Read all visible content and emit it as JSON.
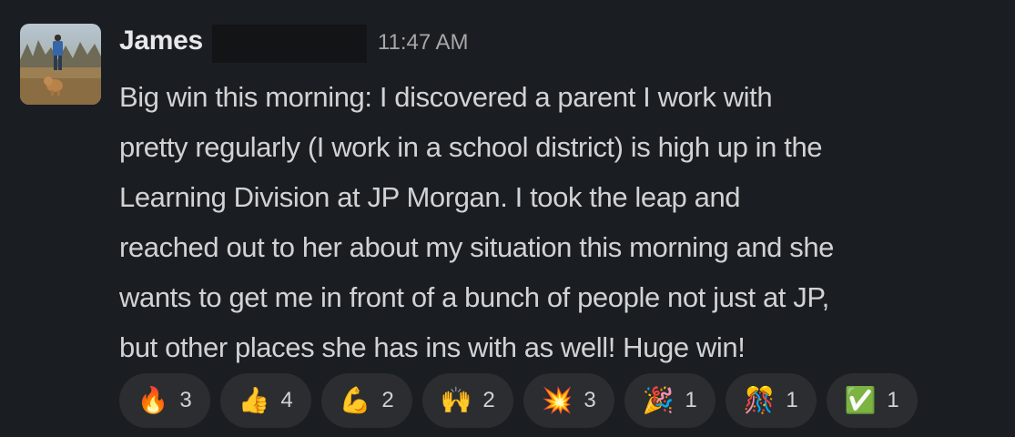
{
  "message": {
    "author": "James",
    "timestamp": "11:47 AM",
    "lines": [
      "Big win this morning: I discovered a parent I work with",
      "pretty regularly (I work in a school district) is high up in the",
      "Learning Division at JP Morgan. I took the leap and",
      "reached out to her about my situation this morning and she",
      "wants to get me in front of a bunch of people not just at JP,",
      "but other places she has ins with as well! Huge win!"
    ]
  },
  "reactions": [
    {
      "icon": "fire-icon",
      "glyph": "🔥",
      "color": "#f4900c",
      "count": "3"
    },
    {
      "icon": "thumbs-up-icon",
      "glyph": "👍",
      "color": "#ffcc4d",
      "count": "4"
    },
    {
      "icon": "flexed-biceps-icon",
      "glyph": "💪",
      "color": "#ffcc4d",
      "count": "2"
    },
    {
      "icon": "raising-hands-icon",
      "glyph": "🙌",
      "color": "#ffcc4d",
      "count": "2"
    },
    {
      "icon": "collision-icon",
      "glyph": "💥",
      "color": "#f4900c",
      "count": "3"
    },
    {
      "icon": "party-popper-icon",
      "glyph": "🎉",
      "color": "#dd2e44",
      "count": "1"
    },
    {
      "icon": "confetti-ball-icon",
      "glyph": "🎊",
      "color": "#3b88c3",
      "count": "1"
    },
    {
      "icon": "check-mark-button-icon",
      "glyph": "✅",
      "color": "#77b255",
      "count": "1"
    }
  ]
}
